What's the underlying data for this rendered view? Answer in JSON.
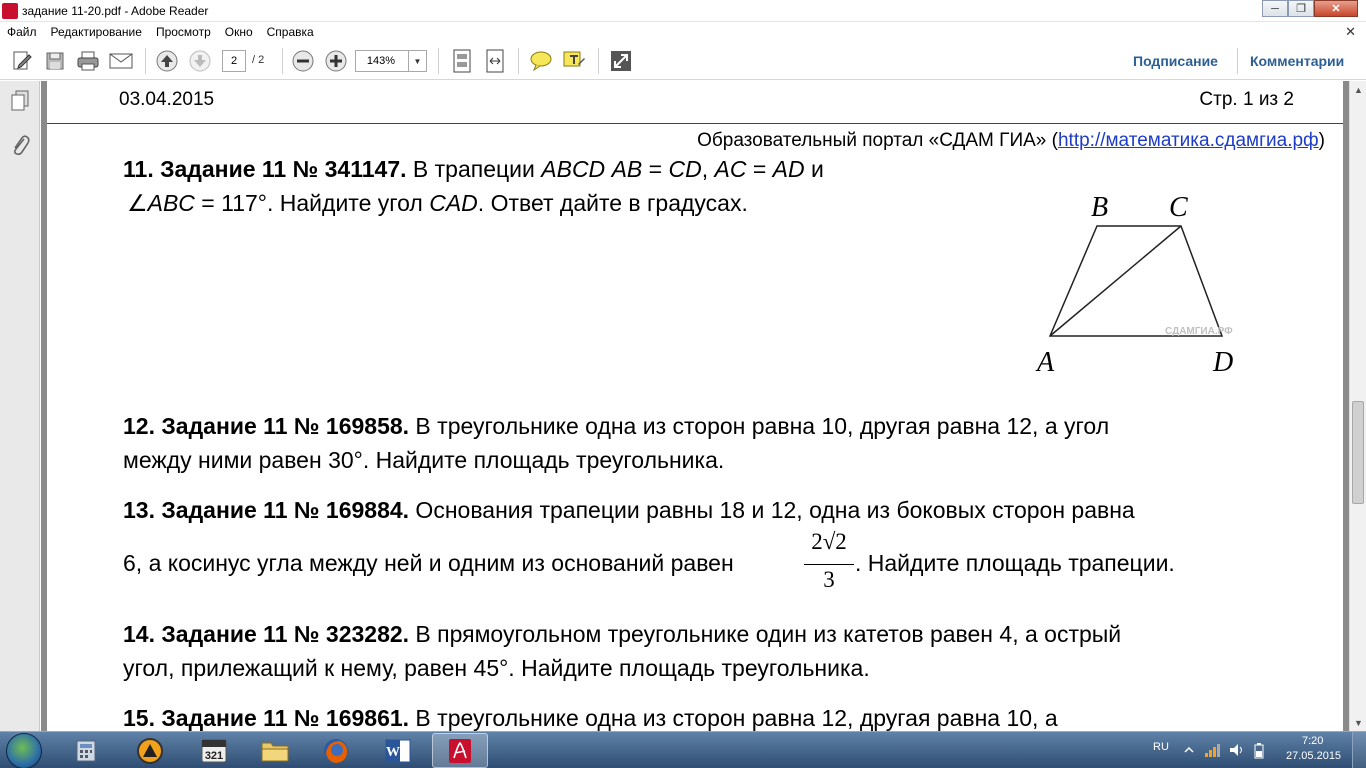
{
  "window": {
    "title": "задание 11-20.pdf - Adobe Reader",
    "min_glyph": "─",
    "restore_glyph": "❐",
    "close_glyph": "✕"
  },
  "menu": {
    "items": [
      "Файл",
      "Редактирование",
      "Просмотр",
      "Окно",
      "Справка"
    ],
    "close_glyph": "✕"
  },
  "toolbar": {
    "page_current": "2",
    "page_total": "/ 2",
    "zoom": "143%",
    "zoom_arrow": "▼",
    "sign_label": "Подписание",
    "comments_label": "Комментарии",
    "icons": [
      "create-pdf-icon",
      "save-icon",
      "print-icon",
      "email-icon",
      "page-up-icon",
      "page-down-icon",
      "zoom-out-icon",
      "zoom-in-icon",
      "fit-page-icon",
      "fit-width-icon",
      "sticky-note-icon",
      "highlight-icon",
      "full-screen-icon"
    ]
  },
  "document": {
    "header_date": "03.04.2015",
    "header_page": "Стр. 1 из 2",
    "portal_prefix": "Образовательный портал «СДАМ ГИА» (",
    "portal_link": "http://математика.сдамгиа.рф",
    "portal_suffix": ")",
    "task11": {
      "num": "11. Задание 11 № 341147.",
      "line1_a": " В   трапеции ",
      "line1_b": "ABCD",
      "line1_c": "  ",
      "line1_d": "AB",
      "line1_e": "   = ",
      "line1_f": "CD",
      "line1_g": ",  ",
      "line1_h": "AC",
      "line1_i": "   = ",
      "line1_j": "AD",
      "line1_k": "  и",
      "line2_a": "∠",
      "line2_b": "ABC",
      "line2_c": " = 117°. Найдите угол ",
      "line2_d": "CAD",
      "line2_e": ". Ответ дайте в градусах."
    },
    "figure": {
      "labels": {
        "A": "A",
        "B": "B",
        "C": "C",
        "D": "D"
      },
      "watermark": "СДАМГИА.РФ"
    },
    "task12": {
      "num": "12. Задание 11 № 169858.",
      "line1": " В треугольнике одна из сторон равна 10, другая равна 12, а угол",
      "line2": "между ними равен 30°. Найдите площадь треугольника."
    },
    "task13": {
      "num": "13. Задание 11 № 169884.",
      "line1": " Основания трапеции равны 18 и 12, одна из боковых сторон равна",
      "line2_a": "6, а косинус угла между ней и одним из оснований равен",
      "frac_num": "2√2",
      "frac_den": "3",
      "line2_b": ". Найдите площадь трапеции."
    },
    "task14": {
      "num": "14. Задание 11 № 323282.",
      "line1": " В прямоугольном треугольнике один из катетов равен 4, а острый",
      "line2": "угол, прилежащий к нему, равен 45°. Найдите площадь треугольника."
    },
    "task15": {
      "num": "15. Задание 11 № 169861.",
      "line1": "  В  треугольнике  одна  из  сторон  равна  12,  другая  равна  10,  а"
    }
  },
  "taskbar": {
    "apps": [
      "explorer-icon",
      "calculator-icon",
      "aimp-icon",
      "calendar-321-icon",
      "folder-icon",
      "firefox-icon",
      "word-icon",
      "adobe-reader-icon"
    ],
    "active_app": "adobe-reader-icon",
    "calendar_text": "321",
    "word_text": "W",
    "lang": "RU",
    "time": "7:20",
    "date": "27.05.2015"
  },
  "colors": {
    "link": "#1d3cc7",
    "toolbar_link": "#2c5f94",
    "reader_red": "#c8102e",
    "taskbar": "#3d5f86"
  }
}
